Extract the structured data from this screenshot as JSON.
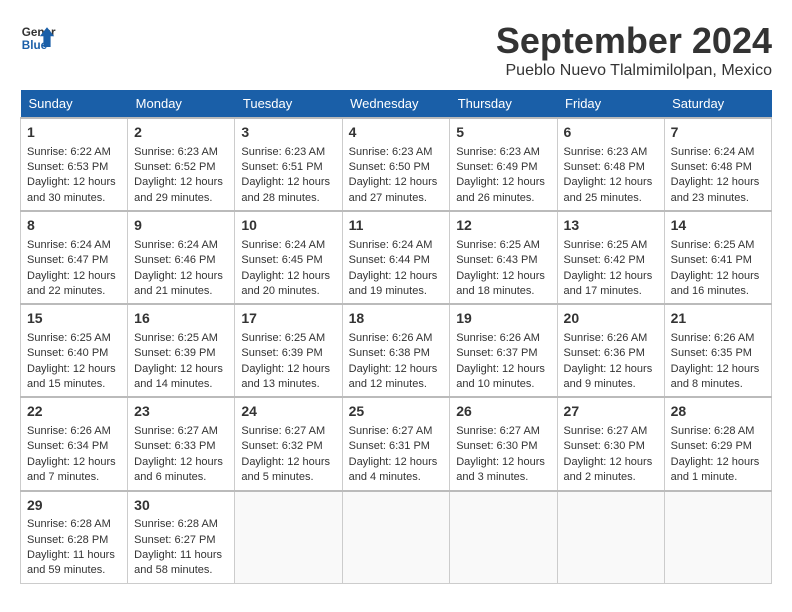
{
  "header": {
    "logo_line1": "General",
    "logo_line2": "Blue",
    "month": "September 2024",
    "location": "Pueblo Nuevo Tlalmimilolpan, Mexico"
  },
  "weekdays": [
    "Sunday",
    "Monday",
    "Tuesday",
    "Wednesday",
    "Thursday",
    "Friday",
    "Saturday"
  ],
  "weeks": [
    [
      {
        "day": "1",
        "sunrise": "Sunrise: 6:22 AM",
        "sunset": "Sunset: 6:53 PM",
        "daylight": "Daylight: 12 hours and 30 minutes."
      },
      {
        "day": "2",
        "sunrise": "Sunrise: 6:23 AM",
        "sunset": "Sunset: 6:52 PM",
        "daylight": "Daylight: 12 hours and 29 minutes."
      },
      {
        "day": "3",
        "sunrise": "Sunrise: 6:23 AM",
        "sunset": "Sunset: 6:51 PM",
        "daylight": "Daylight: 12 hours and 28 minutes."
      },
      {
        "day": "4",
        "sunrise": "Sunrise: 6:23 AM",
        "sunset": "Sunset: 6:50 PM",
        "daylight": "Daylight: 12 hours and 27 minutes."
      },
      {
        "day": "5",
        "sunrise": "Sunrise: 6:23 AM",
        "sunset": "Sunset: 6:49 PM",
        "daylight": "Daylight: 12 hours and 26 minutes."
      },
      {
        "day": "6",
        "sunrise": "Sunrise: 6:23 AM",
        "sunset": "Sunset: 6:48 PM",
        "daylight": "Daylight: 12 hours and 25 minutes."
      },
      {
        "day": "7",
        "sunrise": "Sunrise: 6:24 AM",
        "sunset": "Sunset: 6:48 PM",
        "daylight": "Daylight: 12 hours and 23 minutes."
      }
    ],
    [
      {
        "day": "8",
        "sunrise": "Sunrise: 6:24 AM",
        "sunset": "Sunset: 6:47 PM",
        "daylight": "Daylight: 12 hours and 22 minutes."
      },
      {
        "day": "9",
        "sunrise": "Sunrise: 6:24 AM",
        "sunset": "Sunset: 6:46 PM",
        "daylight": "Daylight: 12 hours and 21 minutes."
      },
      {
        "day": "10",
        "sunrise": "Sunrise: 6:24 AM",
        "sunset": "Sunset: 6:45 PM",
        "daylight": "Daylight: 12 hours and 20 minutes."
      },
      {
        "day": "11",
        "sunrise": "Sunrise: 6:24 AM",
        "sunset": "Sunset: 6:44 PM",
        "daylight": "Daylight: 12 hours and 19 minutes."
      },
      {
        "day": "12",
        "sunrise": "Sunrise: 6:25 AM",
        "sunset": "Sunset: 6:43 PM",
        "daylight": "Daylight: 12 hours and 18 minutes."
      },
      {
        "day": "13",
        "sunrise": "Sunrise: 6:25 AM",
        "sunset": "Sunset: 6:42 PM",
        "daylight": "Daylight: 12 hours and 17 minutes."
      },
      {
        "day": "14",
        "sunrise": "Sunrise: 6:25 AM",
        "sunset": "Sunset: 6:41 PM",
        "daylight": "Daylight: 12 hours and 16 minutes."
      }
    ],
    [
      {
        "day": "15",
        "sunrise": "Sunrise: 6:25 AM",
        "sunset": "Sunset: 6:40 PM",
        "daylight": "Daylight: 12 hours and 15 minutes."
      },
      {
        "day": "16",
        "sunrise": "Sunrise: 6:25 AM",
        "sunset": "Sunset: 6:39 PM",
        "daylight": "Daylight: 12 hours and 14 minutes."
      },
      {
        "day": "17",
        "sunrise": "Sunrise: 6:25 AM",
        "sunset": "Sunset: 6:39 PM",
        "daylight": "Daylight: 12 hours and 13 minutes."
      },
      {
        "day": "18",
        "sunrise": "Sunrise: 6:26 AM",
        "sunset": "Sunset: 6:38 PM",
        "daylight": "Daylight: 12 hours and 12 minutes."
      },
      {
        "day": "19",
        "sunrise": "Sunrise: 6:26 AM",
        "sunset": "Sunset: 6:37 PM",
        "daylight": "Daylight: 12 hours and 10 minutes."
      },
      {
        "day": "20",
        "sunrise": "Sunrise: 6:26 AM",
        "sunset": "Sunset: 6:36 PM",
        "daylight": "Daylight: 12 hours and 9 minutes."
      },
      {
        "day": "21",
        "sunrise": "Sunrise: 6:26 AM",
        "sunset": "Sunset: 6:35 PM",
        "daylight": "Daylight: 12 hours and 8 minutes."
      }
    ],
    [
      {
        "day": "22",
        "sunrise": "Sunrise: 6:26 AM",
        "sunset": "Sunset: 6:34 PM",
        "daylight": "Daylight: 12 hours and 7 minutes."
      },
      {
        "day": "23",
        "sunrise": "Sunrise: 6:27 AM",
        "sunset": "Sunset: 6:33 PM",
        "daylight": "Daylight: 12 hours and 6 minutes."
      },
      {
        "day": "24",
        "sunrise": "Sunrise: 6:27 AM",
        "sunset": "Sunset: 6:32 PM",
        "daylight": "Daylight: 12 hours and 5 minutes."
      },
      {
        "day": "25",
        "sunrise": "Sunrise: 6:27 AM",
        "sunset": "Sunset: 6:31 PM",
        "daylight": "Daylight: 12 hours and 4 minutes."
      },
      {
        "day": "26",
        "sunrise": "Sunrise: 6:27 AM",
        "sunset": "Sunset: 6:30 PM",
        "daylight": "Daylight: 12 hours and 3 minutes."
      },
      {
        "day": "27",
        "sunrise": "Sunrise: 6:27 AM",
        "sunset": "Sunset: 6:30 PM",
        "daylight": "Daylight: 12 hours and 2 minutes."
      },
      {
        "day": "28",
        "sunrise": "Sunrise: 6:28 AM",
        "sunset": "Sunset: 6:29 PM",
        "daylight": "Daylight: 12 hours and 1 minute."
      }
    ],
    [
      {
        "day": "29",
        "sunrise": "Sunrise: 6:28 AM",
        "sunset": "Sunset: 6:28 PM",
        "daylight": "Daylight: 11 hours and 59 minutes."
      },
      {
        "day": "30",
        "sunrise": "Sunrise: 6:28 AM",
        "sunset": "Sunset: 6:27 PM",
        "daylight": "Daylight: 11 hours and 58 minutes."
      },
      null,
      null,
      null,
      null,
      null
    ]
  ]
}
